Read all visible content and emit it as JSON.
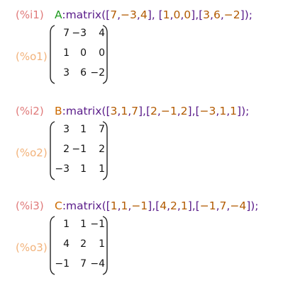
{
  "cells": [
    {
      "in_label": "(%i1)",
      "out_label": "(%o1)",
      "name": "A",
      "input_parts": [
        {
          "t": "A",
          "c": "name-g"
        },
        {
          "t": ":matrix(",
          "c": "txt"
        },
        {
          "t": "[",
          "c": "txt"
        },
        {
          "t": "7",
          "c": "num"
        },
        {
          "t": ",",
          "c": "txt"
        },
        {
          "t": "−3",
          "c": "num"
        },
        {
          "t": ",",
          "c": "txt"
        },
        {
          "t": "4",
          "c": "num"
        },
        {
          "t": "], [",
          "c": "txt"
        },
        {
          "t": "1",
          "c": "num"
        },
        {
          "t": ",",
          "c": "txt"
        },
        {
          "t": "0",
          "c": "num"
        },
        {
          "t": ",",
          "c": "txt"
        },
        {
          "t": "0",
          "c": "num"
        },
        {
          "t": "],[",
          "c": "txt"
        },
        {
          "t": "3",
          "c": "num"
        },
        {
          "t": ",",
          "c": "txt"
        },
        {
          "t": "6",
          "c": "num"
        },
        {
          "t": ",",
          "c": "txt"
        },
        {
          "t": "−2",
          "c": "num"
        },
        {
          "t": "]);",
          "c": "txt"
        }
      ],
      "rows": [
        [
          "7",
          "−3",
          "4"
        ],
        [
          "1",
          "0",
          "0"
        ],
        [
          "3",
          "6",
          "−2"
        ]
      ]
    },
    {
      "in_label": "(%i2)",
      "out_label": "(%o2)",
      "name": "B",
      "input_parts": [
        {
          "t": "B",
          "c": "name-o"
        },
        {
          "t": ":matrix(",
          "c": "txt"
        },
        {
          "t": "[",
          "c": "txt"
        },
        {
          "t": "3",
          "c": "num"
        },
        {
          "t": ",",
          "c": "txt"
        },
        {
          "t": "1",
          "c": "num"
        },
        {
          "t": ",",
          "c": "txt"
        },
        {
          "t": "7",
          "c": "num"
        },
        {
          "t": "],[",
          "c": "txt"
        },
        {
          "t": "2",
          "c": "num"
        },
        {
          "t": ",",
          "c": "txt"
        },
        {
          "t": "−1",
          "c": "num"
        },
        {
          "t": ",",
          "c": "txt"
        },
        {
          "t": "2",
          "c": "num"
        },
        {
          "t": "],[",
          "c": "txt"
        },
        {
          "t": "−3",
          "c": "num"
        },
        {
          "t": ",",
          "c": "txt"
        },
        {
          "t": "1",
          "c": "num"
        },
        {
          "t": ",",
          "c": "txt"
        },
        {
          "t": "1",
          "c": "num"
        },
        {
          "t": "]);",
          "c": "txt"
        }
      ],
      "rows": [
        [
          "3",
          "1",
          "7"
        ],
        [
          "2",
          "−1",
          "2"
        ],
        [
          "−3",
          "1",
          "1"
        ]
      ]
    },
    {
      "in_label": "(%i3)",
      "out_label": "(%o3)",
      "name": "C",
      "input_parts": [
        {
          "t": "C",
          "c": "name-o"
        },
        {
          "t": ":matrix(",
          "c": "txt"
        },
        {
          "t": "[",
          "c": "txt"
        },
        {
          "t": "1",
          "c": "num"
        },
        {
          "t": ",",
          "c": "txt"
        },
        {
          "t": "1",
          "c": "num"
        },
        {
          "t": ",",
          "c": "txt"
        },
        {
          "t": "−1",
          "c": "num"
        },
        {
          "t": "],[",
          "c": "txt"
        },
        {
          "t": "4",
          "c": "num"
        },
        {
          "t": ",",
          "c": "txt"
        },
        {
          "t": "2",
          "c": "num"
        },
        {
          "t": ",",
          "c": "txt"
        },
        {
          "t": "1",
          "c": "num"
        },
        {
          "t": "],[",
          "c": "txt"
        },
        {
          "t": "−1",
          "c": "num"
        },
        {
          "t": ",",
          "c": "txt"
        },
        {
          "t": "7",
          "c": "num"
        },
        {
          "t": ",",
          "c": "txt"
        },
        {
          "t": "−4",
          "c": "num"
        },
        {
          "t": "]);",
          "c": "txt"
        }
      ],
      "rows": [
        [
          "1",
          "1",
          "−1"
        ],
        [
          "4",
          "2",
          "1"
        ],
        [
          "−1",
          "7",
          "−4"
        ]
      ]
    }
  ]
}
